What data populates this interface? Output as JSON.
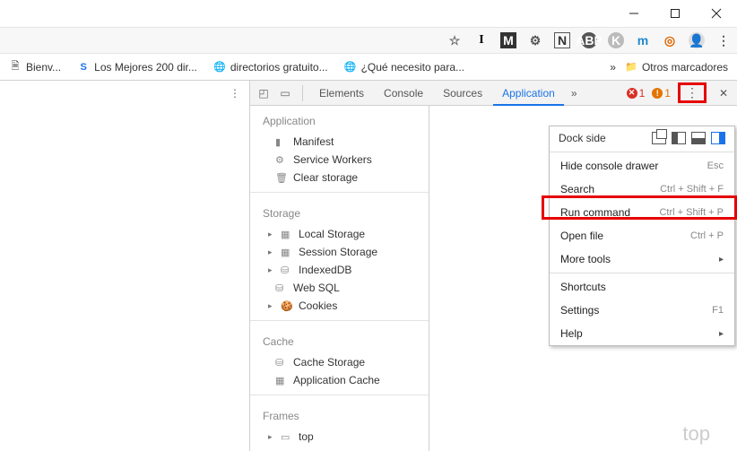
{
  "titlebar": {
    "minimize": "—",
    "maximize": "❐",
    "close": "✕"
  },
  "bookmarks": {
    "items": [
      {
        "icon": "📄",
        "label": "Bienv..."
      },
      {
        "icon": "S",
        "label": "Los Mejores 200 dir...",
        "iconColor": "#1a73e8"
      },
      {
        "icon": "🌐",
        "label": "directorios gratuito..."
      },
      {
        "icon": "🌐",
        "label": "¿Qué necesito para..."
      }
    ],
    "overflow": "»",
    "folder": "Otros marcadores"
  },
  "devtools": {
    "tabs": [
      "Elements",
      "Console",
      "Sources",
      "Application"
    ],
    "activeTab": 3,
    "overflow": "»",
    "errors": "1",
    "warnings": "1",
    "sidebar": {
      "sections": [
        {
          "title": "Application",
          "items": [
            {
              "icon": "▮",
              "label": "Manifest"
            },
            {
              "icon": "⚙",
              "label": "Service Workers"
            },
            {
              "icon": "🗑",
              "label": "Clear storage"
            }
          ]
        },
        {
          "title": "Storage",
          "items": [
            {
              "tri": "▸",
              "icon": "▦",
              "label": "Local Storage"
            },
            {
              "tri": "▸",
              "icon": "▦",
              "label": "Session Storage"
            },
            {
              "tri": "▸",
              "icon": "⛁",
              "label": "IndexedDB"
            },
            {
              "icon": "⛁",
              "label": "Web SQL"
            },
            {
              "tri": "▸",
              "icon": "🍪",
              "label": "Cookies"
            }
          ]
        },
        {
          "title": "Cache",
          "items": [
            {
              "icon": "⛁",
              "label": "Cache Storage"
            },
            {
              "icon": "▦",
              "label": "Application Cache"
            }
          ]
        },
        {
          "title": "Frames",
          "items": [
            {
              "tri": "▸",
              "icon": "▭",
              "label": "top"
            }
          ]
        }
      ]
    },
    "ghost": "top"
  },
  "menu": {
    "dockLabel": "Dock side",
    "items": [
      {
        "label": "Hide console drawer",
        "shortcut": "Esc"
      },
      {
        "label": "Search",
        "shortcut": "Ctrl + Shift + F"
      },
      {
        "label": "Run command",
        "shortcut": "Ctrl + Shift + P"
      },
      {
        "label": "Open file",
        "shortcut": "Ctrl + P"
      },
      {
        "label": "More tools",
        "arrow": true
      }
    ],
    "items2": [
      {
        "label": "Shortcuts"
      },
      {
        "label": "Settings",
        "shortcut": "F1"
      },
      {
        "label": "Help",
        "arrow": true
      }
    ]
  }
}
